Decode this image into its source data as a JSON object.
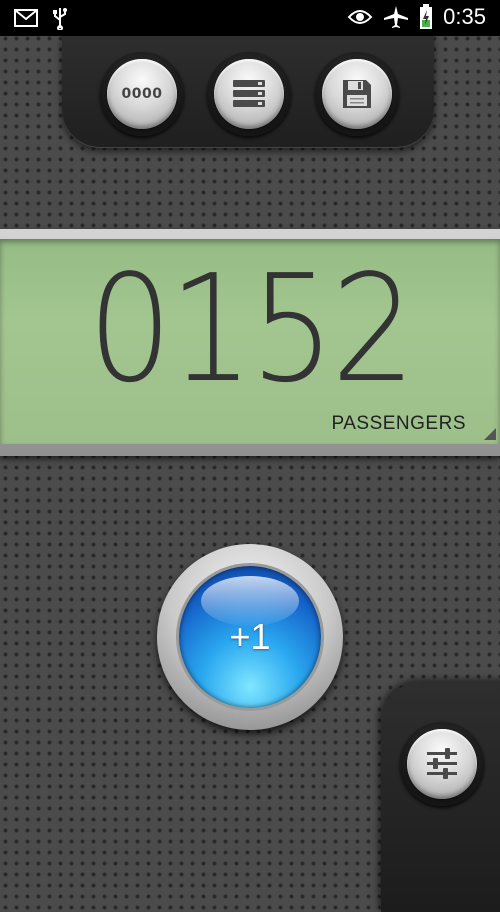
{
  "status_bar": {
    "time": "0:35",
    "left_icons": [
      "mail-icon",
      "usb-icon"
    ],
    "right_icons": [
      "eye-icon",
      "airplane-mode-icon",
      "battery-charging-icon"
    ]
  },
  "toolbar": {
    "reset_label": "0000",
    "buttons": [
      "reset-counter",
      "history-list",
      "save"
    ]
  },
  "display": {
    "count": "0152",
    "unit": "PASSENGERS"
  },
  "increment": {
    "label": "+1"
  },
  "settings": {
    "icon": "sliders-icon"
  },
  "colors": {
    "lcd": "#a3c691",
    "button_blue": "#2aa8f0"
  }
}
